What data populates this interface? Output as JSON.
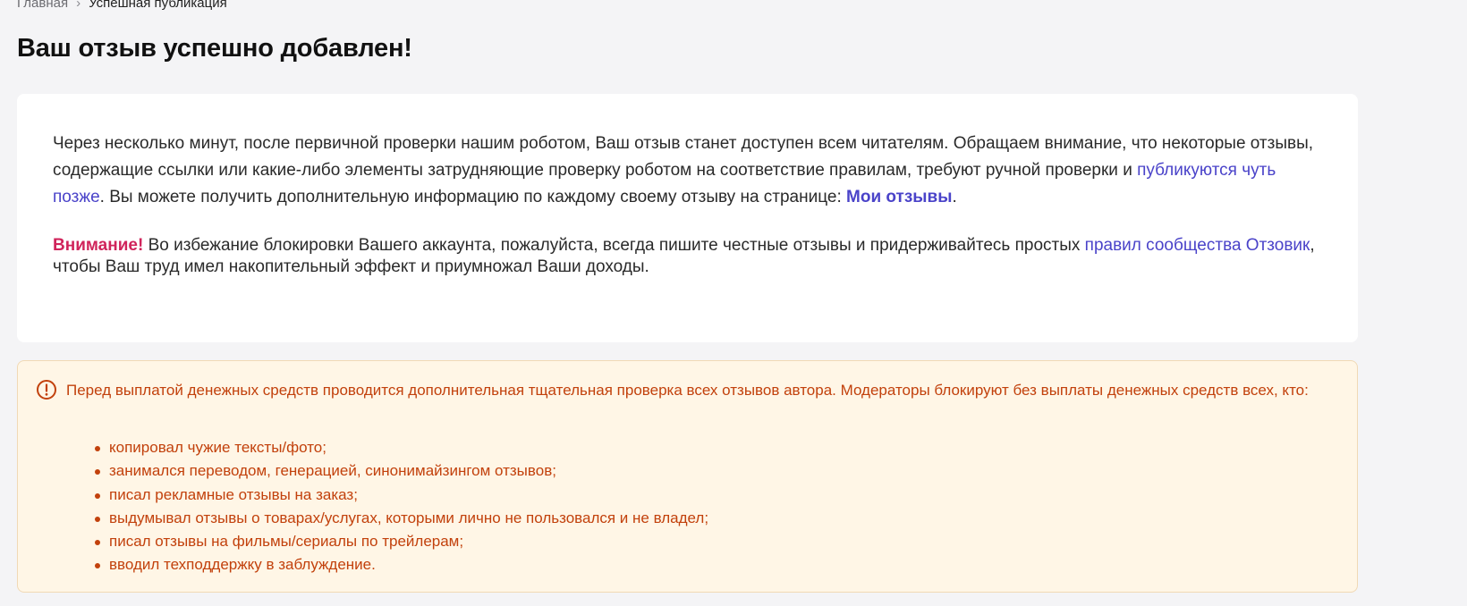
{
  "breadcrumb": {
    "home": "Главная",
    "separator": "›",
    "current": "Успешная публикация"
  },
  "page": {
    "title": "Ваш отзыв успешно добавлен!"
  },
  "success": {
    "text_1": "Через несколько минут, после первичной проверки нашим роботом, Ваш отзыв станет доступен всем читателям. Обращаем внимание, что некоторые отзывы, содержащие ссылки или какие-либо элементы затрудняющие проверку роботом на соответствие правилам, требуют ручной проверки и ",
    "link_later": "публикуются чуть позже",
    "text_2": ". Вы можете получить дополнительную информацию по каждому своему отзыву на странице: ",
    "link_my_reviews": "Мои отзывы",
    "text_3": ".",
    "attention_label": "Внимание!",
    "warning_text_1": " Во избежание блокировки Вашего аккаунта, пожалуйста, всегда пишите честные отзывы и придерживайтесь простых ",
    "link_rules": "правил сообщества Отзовик",
    "warning_text_2": ", чтобы Ваш труд имел накопительный эффект и приумножал Ваши доходы."
  },
  "alert": {
    "icon": "exclamation-circle-icon",
    "text": "Перед выплатой денежных средств проводится дополнительная тщательная проверка всех отзывов автора. Модераторы блокируют без выплаты денежных средств всех, кто:",
    "items": [
      "копировал чужие тексты/фото;",
      "занимался переводом, генерацией, синонимайзингом отзывов;",
      "писал рекламные отзывы на заказ;",
      "выдумывал отзывы о товарах/услугах, которыми лично не пользовался и не владел;",
      "писал отзывы на фильмы/сериалы по трейлерам;",
      "вводил техподдержку в заблуждение."
    ]
  },
  "colors": {
    "background": "#f4f4f6",
    "link": "#4a43c9",
    "attention": "#d0245b",
    "alert_text": "#c2410c",
    "alert_bg": "#fff6e6"
  }
}
